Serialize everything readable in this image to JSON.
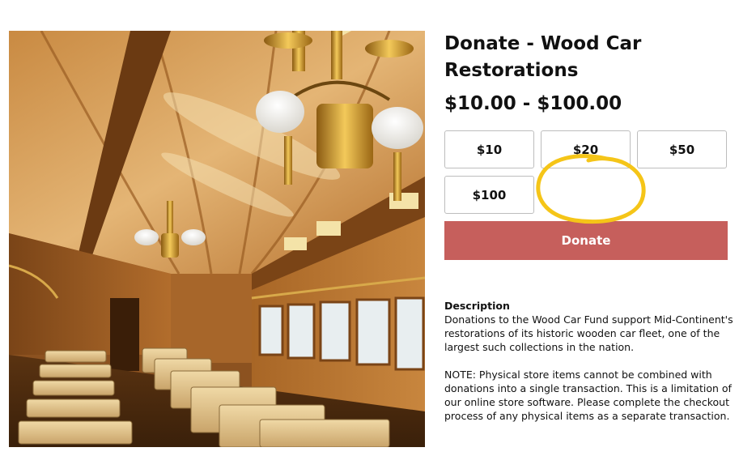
{
  "product": {
    "title": "Donate - Wood Car Restorations",
    "price_range": "$10.00 - $100.00",
    "image_alt": "Interior of a restored wooden railway passenger car with brass chandeliers and wicker seats"
  },
  "amount_options": [
    {
      "label": "$10"
    },
    {
      "label": "$20"
    },
    {
      "label": "$50"
    },
    {
      "label": "$100"
    }
  ],
  "donate_button": {
    "label": "Donate",
    "color": "#c65f5c"
  },
  "annotation": {
    "color": "#f5c518"
  },
  "description": {
    "heading": "Description",
    "body": "Donations to the Wood Car Fund support Mid-Continent's restorations of its historic wooden car fleet, one of the largest such collections in the nation.",
    "note": "NOTE: Physical store items cannot be combined with donations into a single transaction. This is a limitation of our online store software. Please complete the checkout process of any physical items as a separate transaction."
  }
}
